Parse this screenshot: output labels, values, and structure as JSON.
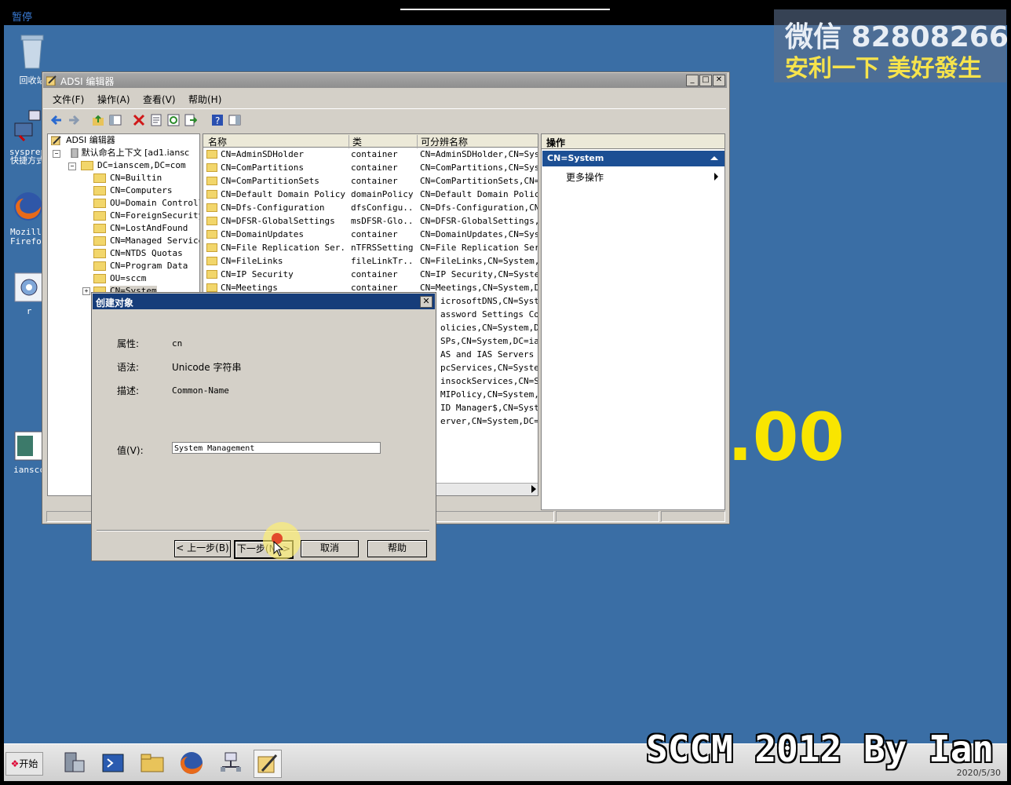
{
  "overlay": {
    "pause_label": "暂停",
    "wechat": "微信 82808266",
    "slogan": "安利一下 美好發生",
    "big_number": ".00",
    "footer_title": "SCCM 2012 By Ian"
  },
  "desktop": {
    "icons": [
      {
        "label": "回收站"
      },
      {
        "label": "sysprep 快捷方式"
      },
      {
        "label": "Mozilla Firefox"
      },
      {
        "label": "r"
      },
      {
        "label": "ianscc"
      }
    ]
  },
  "window": {
    "title": "ADSI 编辑器",
    "menu": [
      "文件(F)",
      "操作(A)",
      "查看(V)",
      "帮助(H)"
    ],
    "tree": {
      "root": "ADSI 编辑器",
      "context": "默认命名上下文 [ad1.iansc",
      "domain": "DC=ianscem,DC=com",
      "children": [
        "CN=Builtin",
        "CN=Computers",
        "OU=Domain Controlle",
        "CN=ForeignSecurityP",
        "CN=LostAndFound",
        "CN=Managed Service",
        "CN=NTDS Quotas",
        "CN=Program Data",
        "OU=sccm",
        "CN=System"
      ]
    },
    "list": {
      "columns": [
        "名称",
        "类",
        "可分辨名称"
      ],
      "rows": [
        {
          "name": "CN=AdminSDHolder",
          "class": "container",
          "dn": "CN=AdminSDHolder,CN=Syste"
        },
        {
          "name": "CN=ComPartitions",
          "class": "container",
          "dn": "CN=ComPartitions,CN=Syste"
        },
        {
          "name": "CN=ComPartitionSets",
          "class": "container",
          "dn": "CN=ComPartitionSets,CN=Sy"
        },
        {
          "name": "CN=Default Domain Policy",
          "class": "domainPolicy",
          "dn": "CN=Default Domain Policy,"
        },
        {
          "name": "CN=Dfs-Configuration",
          "class": "dfsConfigu...",
          "dn": "CN=Dfs-Configuration,CN=S"
        },
        {
          "name": "CN=DFSR-GlobalSettings",
          "class": "msDFSR-Glo...",
          "dn": "CN=DFSR-GlobalSettings,CN"
        },
        {
          "name": "CN=DomainUpdates",
          "class": "container",
          "dn": "CN=DomainUpdates,CN=Syste"
        },
        {
          "name": "CN=File Replication Ser...",
          "class": "nTFRSSettings",
          "dn": "CN=File Replication Servi"
        },
        {
          "name": "CN=FileLinks",
          "class": "fileLinkTr...",
          "dn": "CN=FileLinks,CN=System,DC"
        },
        {
          "name": "CN=IP Security",
          "class": "container",
          "dn": "CN=IP Security,CN=System,"
        },
        {
          "name": "CN=Meetings",
          "class": "container",
          "dn": "CN=Meetings,CN=System,DC="
        }
      ],
      "hidden_dn_tails": [
        "icrosoftDNS,CN=System",
        "assword Settings Cont",
        "olicies,CN=System,DC=",
        "SPs,CN=System,DC=ians",
        "AS and IAS Servers Ac",
        "pcServices,CN=System,",
        "insockServices,CN=Sys",
        "MIPolicy,CN=System,DC",
        "ID Manager$,CN=System",
        "erver,CN=System,DC=ia"
      ]
    },
    "actions": {
      "header": "操作",
      "selected": "CN=System",
      "more": "更多操作"
    }
  },
  "dialog": {
    "title": "创建对象",
    "attr_label": "属性:",
    "attr_value": "cn",
    "syntax_label": "语法:",
    "syntax_value": "Unicode 字符串",
    "desc_label": "描述:",
    "desc_value": "Common-Name",
    "value_label": "值(V):",
    "value_input": "System Management",
    "buttons": {
      "back": "< 上一步(B)",
      "next": "下一步(N) >",
      "cancel": "取消",
      "help": "帮助"
    }
  },
  "taskbar": {
    "start": "开始",
    "date": "2020/5/30"
  },
  "colors": {
    "desktop": "#3a6ea5",
    "selection": "#1c4f94",
    "dialog_title": "#163d7a",
    "accent_yellow": "#f9e500"
  }
}
